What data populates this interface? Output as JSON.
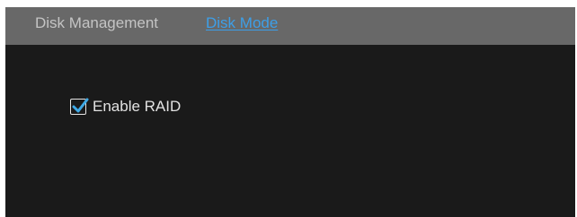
{
  "tabs": [
    {
      "label": "Disk Management",
      "active": false
    },
    {
      "label": "Disk Mode",
      "active": true
    }
  ],
  "raid": {
    "label": "Enable RAID",
    "checked": true
  },
  "colors": {
    "tabbar_bg": "#686868",
    "content_bg": "#1a1a1a",
    "active_tab": "#3d9fe8",
    "inactive_tab": "#c4c4c4",
    "checkmark": "#3fa9e6"
  },
  "icons": {
    "checkbox": "checkmark-icon"
  }
}
